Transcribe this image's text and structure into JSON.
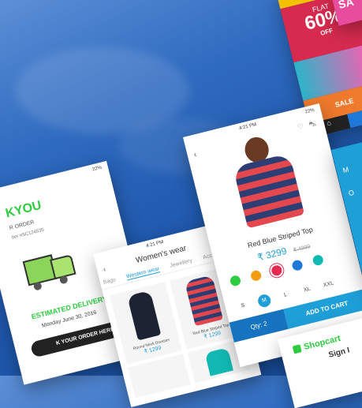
{
  "status": {
    "battery": "22%",
    "time": "4:21 PM"
  },
  "thankyou": {
    "heading": "KYOU",
    "line1": "R ORDER",
    "line2": "ber #SC124535",
    "estimated": "ESTIMATED DELIVERY",
    "date": "Monday June 30, 2016",
    "track": "K YOUR ORDER HERE"
  },
  "listing": {
    "title": "Women's wear",
    "tabs": [
      "Bags",
      "Western wear",
      "Jewellery",
      "Acce"
    ],
    "products": [
      {
        "name": "Round Neck Dresses",
        "price": "₹ 1299"
      },
      {
        "name": "Red Blue Striped Top",
        "price": "₹ 1299"
      }
    ]
  },
  "detail": {
    "name": "Red Blue Striped Top",
    "price": "₹ 3299",
    "old_price": "₹ 4999",
    "colors": [
      "#2ecc40",
      "#f39c12",
      "#e52b50",
      "#1e78d7",
      "#12b9b3"
    ],
    "sizes": [
      "S",
      "M",
      "L",
      "XL",
      "XXL"
    ],
    "qty": "Qty: 2",
    "cta": "ADD TO CART"
  },
  "promo": {
    "flat": "FLAT",
    "percent": "60%",
    "off": "OFF",
    "sale": "SALE",
    "corner": "SA"
  },
  "shopcart": {
    "brand": "Shopcart",
    "sign": "Sign I"
  },
  "bluepanel": {
    "m1": "M",
    "m2": "O"
  }
}
